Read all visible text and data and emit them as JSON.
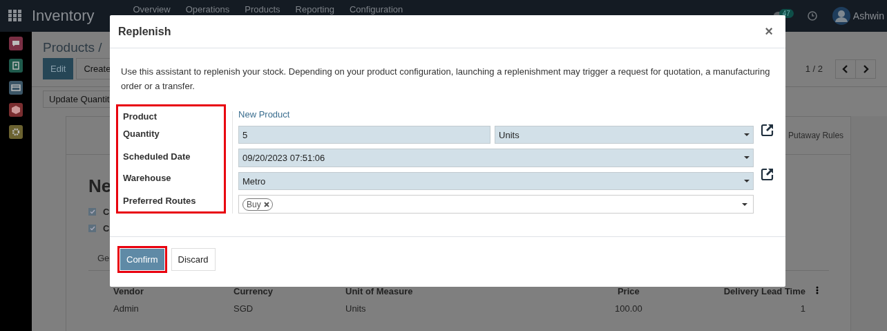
{
  "navbar": {
    "app_name": "Inventory",
    "menu": [
      "Overview",
      "Operations",
      "Products",
      "Reporting",
      "Configuration"
    ],
    "chat_count": "47",
    "user": "Ashwin"
  },
  "sidebar": {
    "apps": [
      {
        "kind": "chat",
        "color": "#7a2f44"
      },
      {
        "kind": "contact",
        "color": "#1f5a4c"
      },
      {
        "kind": "card",
        "color": "#3b5566"
      },
      {
        "kind": "box",
        "color": "#7a2e30"
      },
      {
        "kind": "gear",
        "color": "#6b6230"
      }
    ]
  },
  "page": {
    "breadcrumb": "Products /",
    "buttons": [
      "Edit",
      "Create"
    ],
    "pager": "1 / 2",
    "action": "Update Quantit",
    "sheet_tab": "Putaway Rules",
    "title": "Ne",
    "checkboxes": [
      {
        "label": "C",
        "checked": true
      },
      {
        "label": "C",
        "checked": true
      }
    ],
    "notebook_tab": "Ge",
    "table": {
      "columns": [
        "Vendor",
        "Currency",
        "Unit of Measure",
        "Price",
        "Delivery Lead Time"
      ],
      "rows": [
        [
          "Admin",
          "SGD",
          "Units",
          "100.00",
          "1"
        ]
      ]
    }
  },
  "dialog": {
    "title": "Replenish",
    "close": "×",
    "intro": "Use this assistant to replenish your stock. Depending on your product configuration, launching a replenishment may trigger a request for quotation, a manufacturing order or a transfer.",
    "labels_highlighted": true,
    "fields": [
      {
        "kind": "link",
        "label": "Product",
        "value": "New Product"
      },
      {
        "kind": "quantity",
        "label": "Quantity",
        "value": "5",
        "unit": "Units",
        "open_button": true
      },
      {
        "kind": "select",
        "label": "Scheduled Date",
        "value": "09/20/2023 07:51:06",
        "open_button": false
      },
      {
        "kind": "select",
        "label": "Warehouse",
        "value": "Metro",
        "open_button": true
      },
      {
        "kind": "tags",
        "label": "Preferred Routes",
        "tags": [
          "Buy"
        ]
      }
    ],
    "confirm": {
      "label": "Confirm",
      "highlighted": true
    },
    "discard": {
      "label": "Discard"
    }
  }
}
